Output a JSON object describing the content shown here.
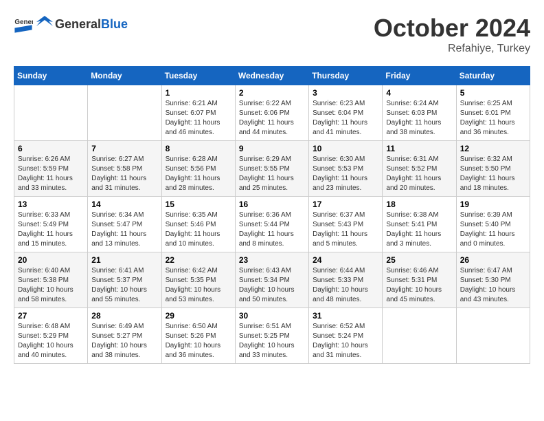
{
  "header": {
    "logo_general": "General",
    "logo_blue": "Blue",
    "month": "October 2024",
    "location": "Refahiye, Turkey"
  },
  "days_of_week": [
    "Sunday",
    "Monday",
    "Tuesday",
    "Wednesday",
    "Thursday",
    "Friday",
    "Saturday"
  ],
  "weeks": [
    [
      {
        "day": "",
        "sunrise": "",
        "sunset": "",
        "daylight": ""
      },
      {
        "day": "",
        "sunrise": "",
        "sunset": "",
        "daylight": ""
      },
      {
        "day": "1",
        "sunrise": "Sunrise: 6:21 AM",
        "sunset": "Sunset: 6:07 PM",
        "daylight": "Daylight: 11 hours and 46 minutes."
      },
      {
        "day": "2",
        "sunrise": "Sunrise: 6:22 AM",
        "sunset": "Sunset: 6:06 PM",
        "daylight": "Daylight: 11 hours and 44 minutes."
      },
      {
        "day": "3",
        "sunrise": "Sunrise: 6:23 AM",
        "sunset": "Sunset: 6:04 PM",
        "daylight": "Daylight: 11 hours and 41 minutes."
      },
      {
        "day": "4",
        "sunrise": "Sunrise: 6:24 AM",
        "sunset": "Sunset: 6:03 PM",
        "daylight": "Daylight: 11 hours and 38 minutes."
      },
      {
        "day": "5",
        "sunrise": "Sunrise: 6:25 AM",
        "sunset": "Sunset: 6:01 PM",
        "daylight": "Daylight: 11 hours and 36 minutes."
      }
    ],
    [
      {
        "day": "6",
        "sunrise": "Sunrise: 6:26 AM",
        "sunset": "Sunset: 5:59 PM",
        "daylight": "Daylight: 11 hours and 33 minutes."
      },
      {
        "day": "7",
        "sunrise": "Sunrise: 6:27 AM",
        "sunset": "Sunset: 5:58 PM",
        "daylight": "Daylight: 11 hours and 31 minutes."
      },
      {
        "day": "8",
        "sunrise": "Sunrise: 6:28 AM",
        "sunset": "Sunset: 5:56 PM",
        "daylight": "Daylight: 11 hours and 28 minutes."
      },
      {
        "day": "9",
        "sunrise": "Sunrise: 6:29 AM",
        "sunset": "Sunset: 5:55 PM",
        "daylight": "Daylight: 11 hours and 25 minutes."
      },
      {
        "day": "10",
        "sunrise": "Sunrise: 6:30 AM",
        "sunset": "Sunset: 5:53 PM",
        "daylight": "Daylight: 11 hours and 23 minutes."
      },
      {
        "day": "11",
        "sunrise": "Sunrise: 6:31 AM",
        "sunset": "Sunset: 5:52 PM",
        "daylight": "Daylight: 11 hours and 20 minutes."
      },
      {
        "day": "12",
        "sunrise": "Sunrise: 6:32 AM",
        "sunset": "Sunset: 5:50 PM",
        "daylight": "Daylight: 11 hours and 18 minutes."
      }
    ],
    [
      {
        "day": "13",
        "sunrise": "Sunrise: 6:33 AM",
        "sunset": "Sunset: 5:49 PM",
        "daylight": "Daylight: 11 hours and 15 minutes."
      },
      {
        "day": "14",
        "sunrise": "Sunrise: 6:34 AM",
        "sunset": "Sunset: 5:47 PM",
        "daylight": "Daylight: 11 hours and 13 minutes."
      },
      {
        "day": "15",
        "sunrise": "Sunrise: 6:35 AM",
        "sunset": "Sunset: 5:46 PM",
        "daylight": "Daylight: 11 hours and 10 minutes."
      },
      {
        "day": "16",
        "sunrise": "Sunrise: 6:36 AM",
        "sunset": "Sunset: 5:44 PM",
        "daylight": "Daylight: 11 hours and 8 minutes."
      },
      {
        "day": "17",
        "sunrise": "Sunrise: 6:37 AM",
        "sunset": "Sunset: 5:43 PM",
        "daylight": "Daylight: 11 hours and 5 minutes."
      },
      {
        "day": "18",
        "sunrise": "Sunrise: 6:38 AM",
        "sunset": "Sunset: 5:41 PM",
        "daylight": "Daylight: 11 hours and 3 minutes."
      },
      {
        "day": "19",
        "sunrise": "Sunrise: 6:39 AM",
        "sunset": "Sunset: 5:40 PM",
        "daylight": "Daylight: 11 hours and 0 minutes."
      }
    ],
    [
      {
        "day": "20",
        "sunrise": "Sunrise: 6:40 AM",
        "sunset": "Sunset: 5:38 PM",
        "daylight": "Daylight: 10 hours and 58 minutes."
      },
      {
        "day": "21",
        "sunrise": "Sunrise: 6:41 AM",
        "sunset": "Sunset: 5:37 PM",
        "daylight": "Daylight: 10 hours and 55 minutes."
      },
      {
        "day": "22",
        "sunrise": "Sunrise: 6:42 AM",
        "sunset": "Sunset: 5:35 PM",
        "daylight": "Daylight: 10 hours and 53 minutes."
      },
      {
        "day": "23",
        "sunrise": "Sunrise: 6:43 AM",
        "sunset": "Sunset: 5:34 PM",
        "daylight": "Daylight: 10 hours and 50 minutes."
      },
      {
        "day": "24",
        "sunrise": "Sunrise: 6:44 AM",
        "sunset": "Sunset: 5:33 PM",
        "daylight": "Daylight: 10 hours and 48 minutes."
      },
      {
        "day": "25",
        "sunrise": "Sunrise: 6:46 AM",
        "sunset": "Sunset: 5:31 PM",
        "daylight": "Daylight: 10 hours and 45 minutes."
      },
      {
        "day": "26",
        "sunrise": "Sunrise: 6:47 AM",
        "sunset": "Sunset: 5:30 PM",
        "daylight": "Daylight: 10 hours and 43 minutes."
      }
    ],
    [
      {
        "day": "27",
        "sunrise": "Sunrise: 6:48 AM",
        "sunset": "Sunset: 5:29 PM",
        "daylight": "Daylight: 10 hours and 40 minutes."
      },
      {
        "day": "28",
        "sunrise": "Sunrise: 6:49 AM",
        "sunset": "Sunset: 5:27 PM",
        "daylight": "Daylight: 10 hours and 38 minutes."
      },
      {
        "day": "29",
        "sunrise": "Sunrise: 6:50 AM",
        "sunset": "Sunset: 5:26 PM",
        "daylight": "Daylight: 10 hours and 36 minutes."
      },
      {
        "day": "30",
        "sunrise": "Sunrise: 6:51 AM",
        "sunset": "Sunset: 5:25 PM",
        "daylight": "Daylight: 10 hours and 33 minutes."
      },
      {
        "day": "31",
        "sunrise": "Sunrise: 6:52 AM",
        "sunset": "Sunset: 5:24 PM",
        "daylight": "Daylight: 10 hours and 31 minutes."
      },
      {
        "day": "",
        "sunrise": "",
        "sunset": "",
        "daylight": ""
      },
      {
        "day": "",
        "sunrise": "",
        "sunset": "",
        "daylight": ""
      }
    ]
  ]
}
